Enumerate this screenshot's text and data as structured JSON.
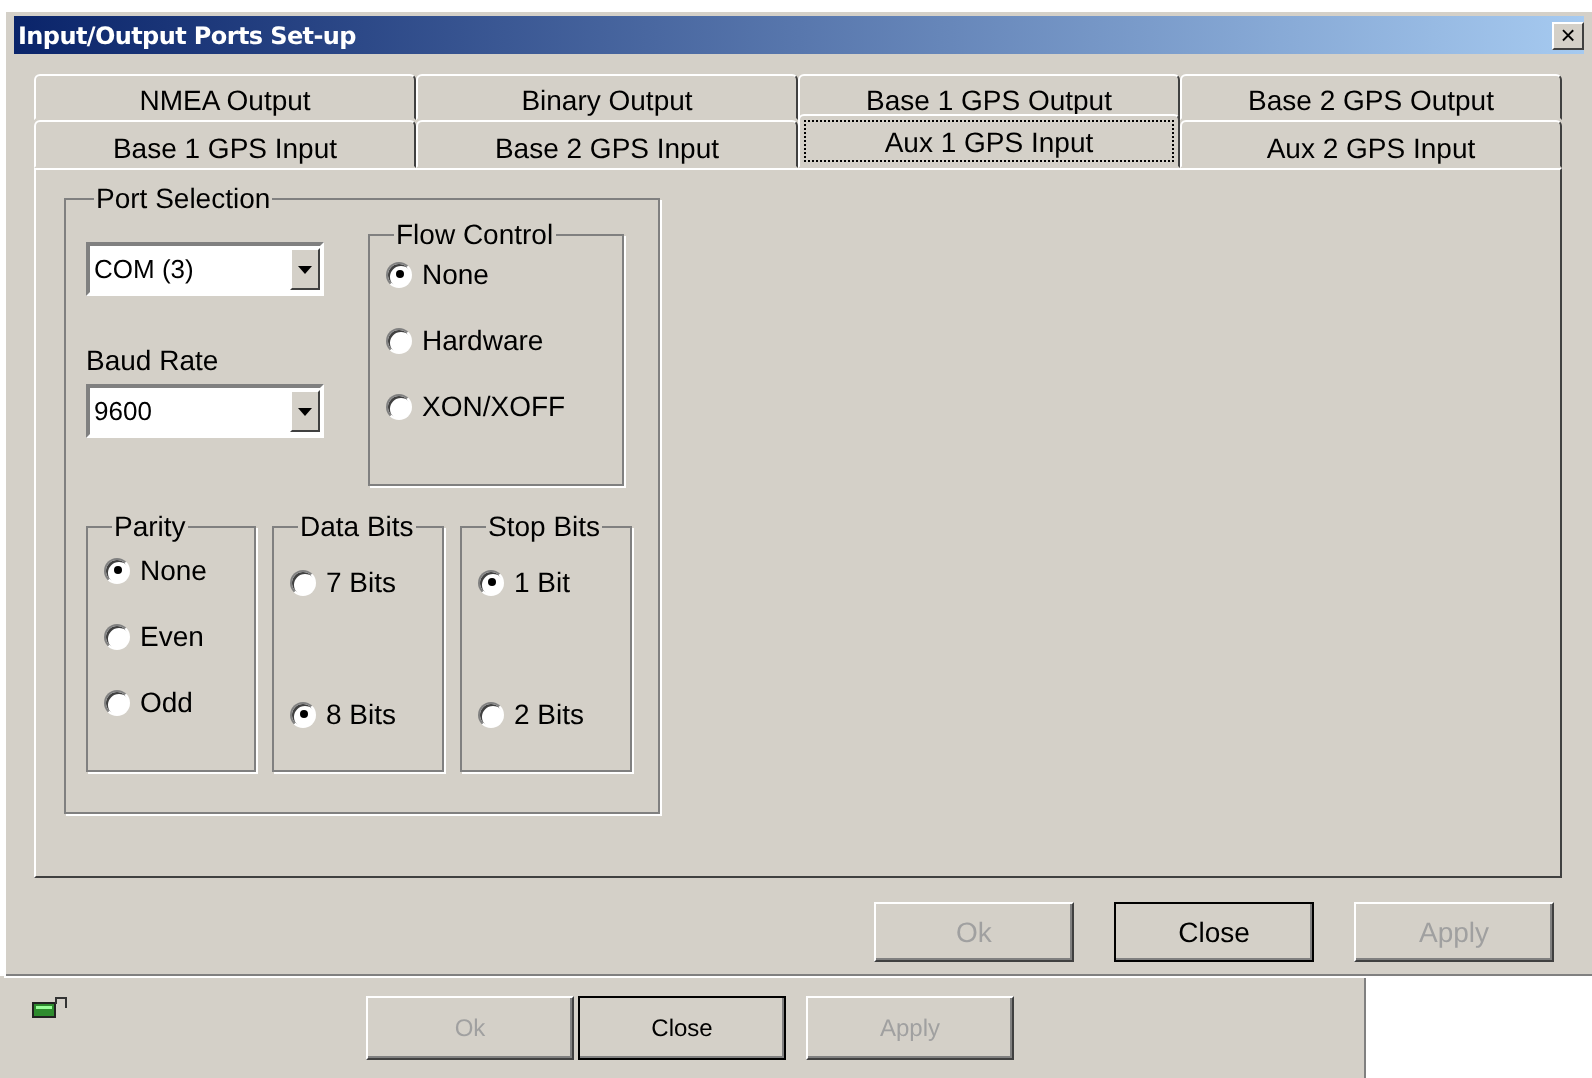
{
  "window": {
    "title": "Input/Output Ports Set-up",
    "close_glyph": "×"
  },
  "tab_rows": [
    [
      {
        "label": "NMEA Output",
        "selected": false
      },
      {
        "label": "Binary Output",
        "selected": false
      },
      {
        "label": "Base 1 GPS Output",
        "selected": false
      },
      {
        "label": "Base 2 GPS Output",
        "selected": false
      }
    ],
    [
      {
        "label": "Base 1 GPS Input",
        "selected": false
      },
      {
        "label": "Base 2 GPS Input",
        "selected": false
      },
      {
        "label": "Aux 1 GPS Input",
        "selected": true
      },
      {
        "label": "Aux 2 GPS Input",
        "selected": false
      }
    ]
  ],
  "port_selection": {
    "title": "Port Selection",
    "port": {
      "value": "COM (3)"
    },
    "baud_rate": {
      "label": "Baud Rate",
      "value": "9600"
    }
  },
  "flow_control": {
    "title": "Flow Control",
    "options": [
      {
        "label": "None",
        "selected": true
      },
      {
        "label": "Hardware",
        "selected": false
      },
      {
        "label": "XON/XOFF",
        "selected": false
      }
    ]
  },
  "groups": [
    {
      "title": "Parity",
      "options": [
        {
          "label": "None",
          "selected": true
        },
        {
          "label": "Even",
          "selected": false
        },
        {
          "label": "Odd",
          "selected": false
        }
      ]
    },
    {
      "title": "Data Bits",
      "options": [
        {
          "label": "7 Bits",
          "selected": false
        },
        {
          "label": "8 Bits",
          "selected": true
        }
      ]
    },
    {
      "title": "Stop Bits",
      "options": [
        {
          "label": "1 Bit",
          "selected": true
        },
        {
          "label": "2 Bits",
          "selected": false
        }
      ]
    }
  ],
  "buttons": [
    {
      "label": "Ok",
      "disabled": true
    },
    {
      "label": "Close",
      "disabled": false
    },
    {
      "label": "Apply",
      "disabled": true
    }
  ],
  "background_window": {
    "buttons": [
      {
        "label": "Ok",
        "disabled": true
      },
      {
        "label": "Close",
        "disabled": false
      },
      {
        "label": "Apply",
        "disabled": true
      }
    ]
  }
}
